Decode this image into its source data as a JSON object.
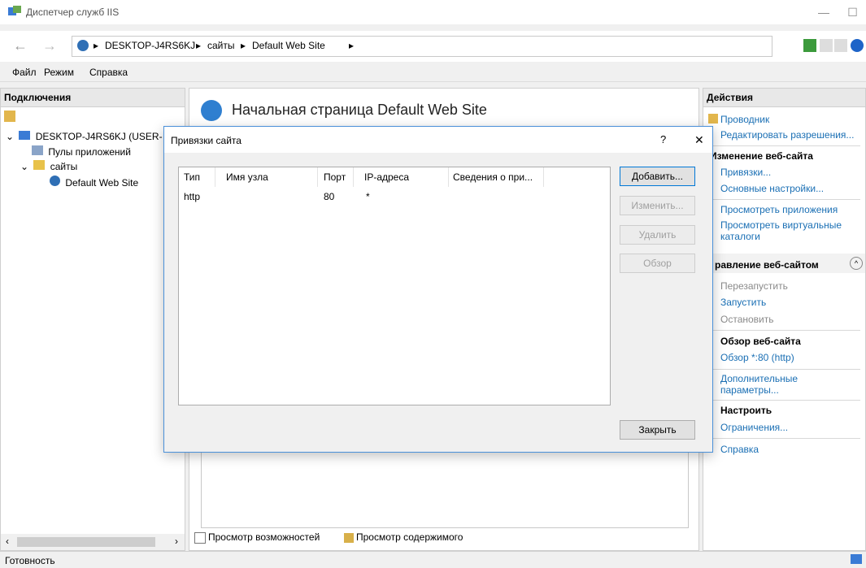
{
  "window": {
    "title": "Диспетчер служб IIS"
  },
  "breadcrumbs": [
    "DESKTOP-J4RS6KJ",
    "сайты",
    "Default Web Site"
  ],
  "menu": {
    "file": "Файл",
    "view": "Режим",
    "help": "Справка"
  },
  "connections": {
    "header": "Подключения",
    "server": "DESKTOP-J4RS6KJ (USER-",
    "app_pools": "Пулы приложений",
    "sites": "сайты",
    "site": "Default Web Site"
  },
  "center": {
    "title": "Начальная страница Default Web Site",
    "features_view": "Просмотр возможностей",
    "content_view": "Просмотр содержимого"
  },
  "actions": {
    "header": "Действия",
    "explore": "Проводник",
    "edit_permissions": "Редактировать разрешения...",
    "edit_site_header": "Изменение веб-сайта",
    "bindings": "Привязки...",
    "basic_settings": "Основные настройки...",
    "view_apps": "Просмотреть приложения",
    "view_vdirs": "Просмотреть виртуальные каталоги",
    "manage_header": "равление веб-сайтом",
    "restart": "Перезапустить",
    "start": "Запустить",
    "stop": "Остановить",
    "browse_header": "Обзор веб-сайта",
    "browse_80": "Обзор *:80 (http)",
    "advanced": "Дополнительные параметры...",
    "configure_header": "Настроить",
    "limits": "Ограничения...",
    "help": "Справка"
  },
  "status": {
    "text": "Готовность"
  },
  "dialog": {
    "title": "Привязки сайта",
    "help": "?",
    "close": "✕",
    "columns": [
      "Тип",
      "Имя узла",
      "Порт",
      "IP-адреса",
      "Сведения о при..."
    ],
    "rows": [
      [
        "http",
        "",
        "80",
        "*",
        ""
      ]
    ],
    "buttons": {
      "add": "Добавить...",
      "edit": "Изменить...",
      "remove": "Удалить",
      "browse": "Обзор",
      "close": "Закрыть"
    }
  }
}
